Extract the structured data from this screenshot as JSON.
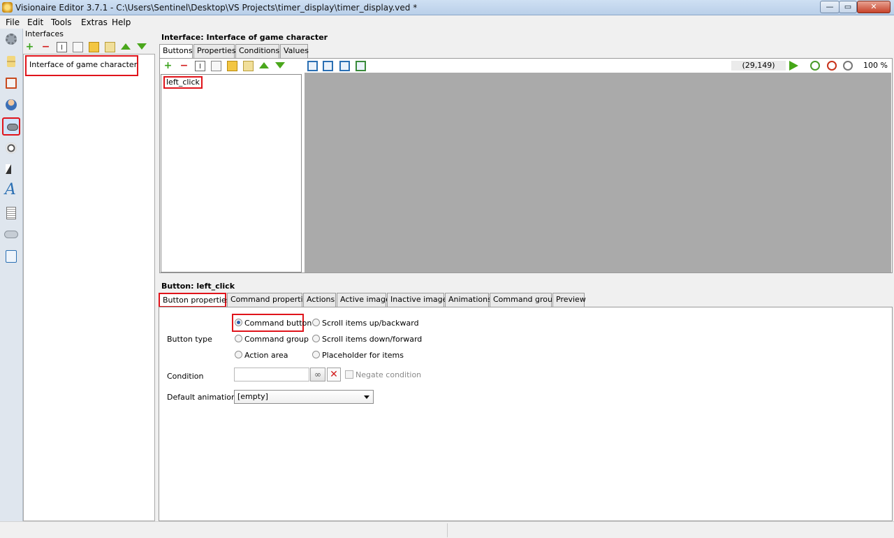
{
  "window": {
    "title": "Visionaire Editor 3.7.1 - C:\\Users\\Sentinel\\Desktop\\VS Projects\\timer_display\\timer_display.ved *",
    "minimize": "—",
    "maximize": "▭",
    "close": "✕"
  },
  "menu": [
    "File",
    "Edit",
    "Tools",
    "Extras",
    "Help"
  ],
  "sidebar_icons": [
    "gear-icon",
    "hourglass-icon",
    "house-icon",
    "character-icon",
    "gamepad-icon",
    "ball-icon",
    "cursor-icon",
    "font-icon",
    "text-document-icon",
    "weather-icon",
    "script-icon"
  ],
  "interfaces": {
    "label": "Interfaces",
    "items": [
      "Interface of game character"
    ]
  },
  "interface_panel": {
    "title": "Interface: Interface of game character",
    "tabs": [
      "Buttons",
      "Properties",
      "Conditions",
      "Values"
    ],
    "buttons": [
      "left_click"
    ],
    "coords": "(29,149)",
    "zoom": "100 %"
  },
  "button_panel": {
    "title": "Button: left_click",
    "tabs": [
      "Button properties",
      "Command properties",
      "Actions",
      "Active image",
      "Inactive image",
      "Animations",
      "Command group",
      "Preview"
    ],
    "button_type_label": "Button type",
    "radios_col1": [
      "Command button",
      "Command group",
      "Action area"
    ],
    "radios_col2": [
      "Scroll items up/backward",
      "Scroll items down/forward",
      "Placeholder for items"
    ],
    "selected_radio": "Command button",
    "condition_label": "Condition",
    "condition_value": "",
    "negate_label": "Negate condition",
    "default_animation_label": "Default animation",
    "default_animation_value": "[empty]"
  },
  "colors": {
    "highlight": "#e0141b",
    "canvas": "#aaaaaa",
    "accent_green": "#3aa21b"
  }
}
